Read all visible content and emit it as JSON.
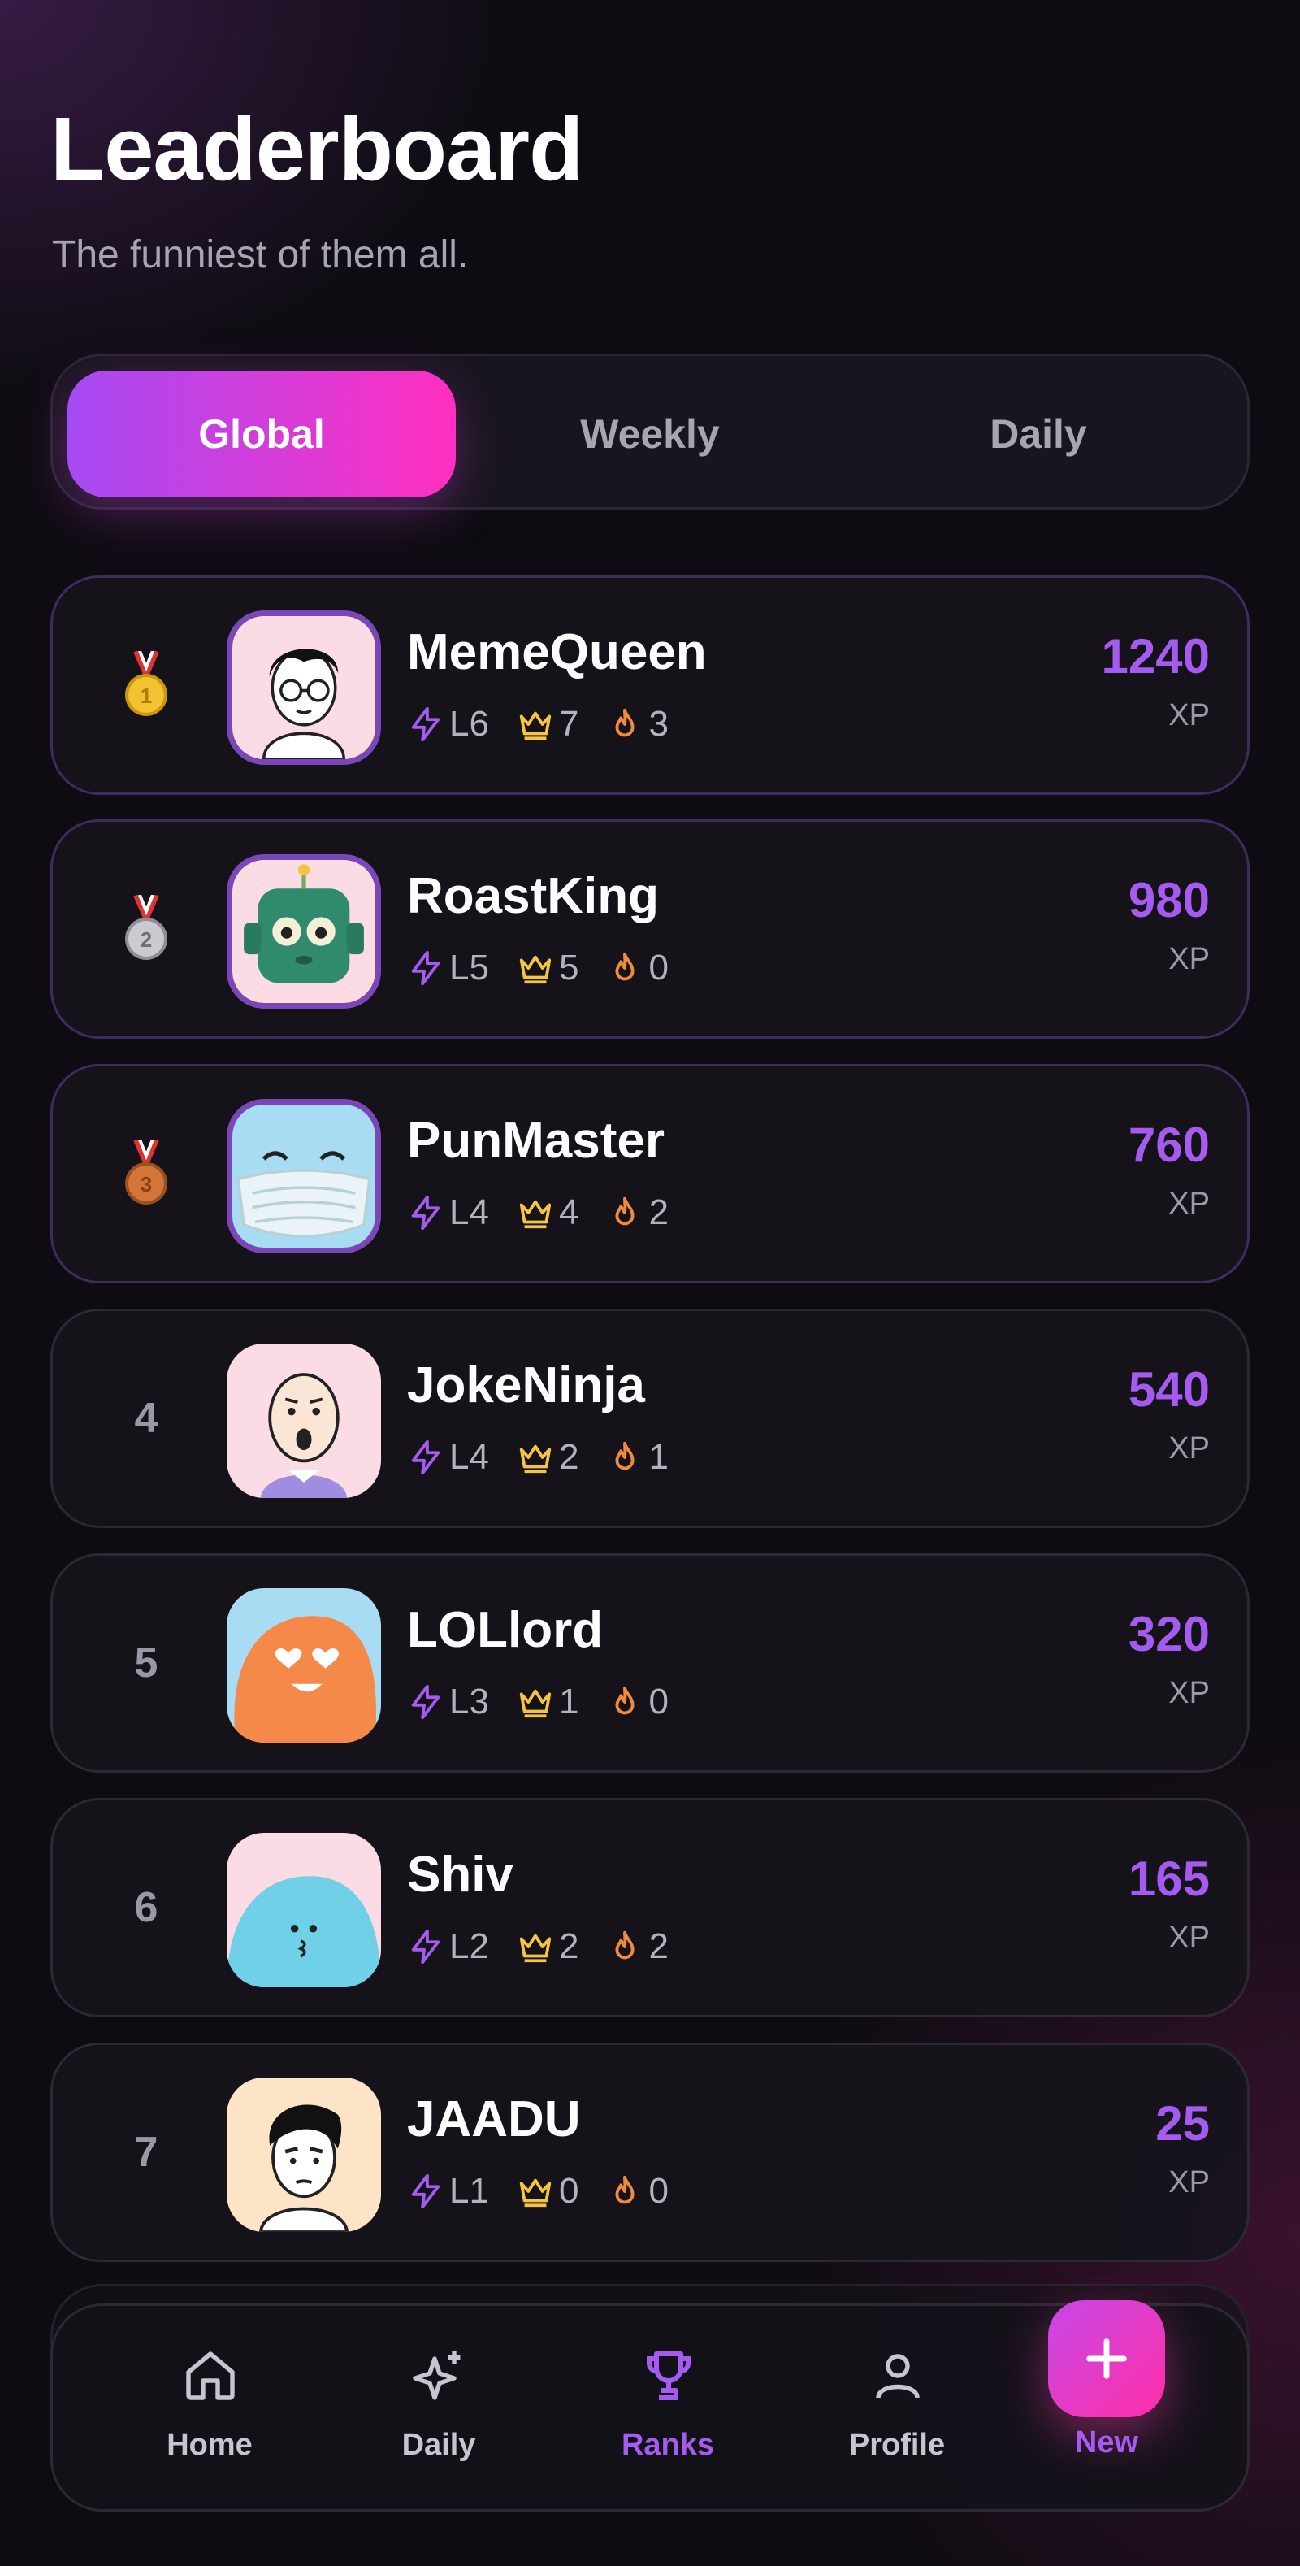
{
  "header": {
    "title": "Leaderboard",
    "subtitle": "The funniest of them all."
  },
  "tabs": [
    {
      "label": "Global",
      "active": true
    },
    {
      "label": "Weekly",
      "active": false
    },
    {
      "label": "Daily",
      "active": false
    }
  ],
  "leaderboard": [
    {
      "rank": "1",
      "medal": "gold",
      "name": "MemeQueen",
      "level": "L6",
      "crowns": "7",
      "streak": "3",
      "score": "1240",
      "unit": "XP",
      "avatar": "glasses-guy-avatar"
    },
    {
      "rank": "2",
      "medal": "silver",
      "name": "RoastKing",
      "level": "L5",
      "crowns": "5",
      "streak": "0",
      "score": "980",
      "unit": "XP",
      "avatar": "green-robot-avatar"
    },
    {
      "rank": "3",
      "medal": "bronze",
      "name": "PunMaster",
      "level": "L4",
      "crowns": "4",
      "streak": "2",
      "score": "760",
      "unit": "XP",
      "avatar": "face-mask-avatar"
    },
    {
      "rank": "4",
      "medal": null,
      "name": "JokeNinja",
      "level": "L4",
      "crowns": "2",
      "streak": "1",
      "score": "540",
      "unit": "XP",
      "avatar": "bald-man-avatar"
    },
    {
      "rank": "5",
      "medal": null,
      "name": "LOLlord",
      "level": "L3",
      "crowns": "1",
      "streak": "0",
      "score": "320",
      "unit": "XP",
      "avatar": "heart-eyes-blob-avatar"
    },
    {
      "rank": "6",
      "medal": null,
      "name": "Shiv",
      "level": "L2",
      "crowns": "2",
      "streak": "2",
      "score": "165",
      "unit": "XP",
      "avatar": "blue-kiss-blob-avatar"
    },
    {
      "rank": "7",
      "medal": null,
      "name": "JAADU",
      "level": "L1",
      "crowns": "0",
      "streak": "0",
      "score": "25",
      "unit": "XP",
      "avatar": "dark-hair-man-avatar"
    }
  ],
  "nav": {
    "items": [
      {
        "label": "Home",
        "icon": "home-icon",
        "active": false
      },
      {
        "label": "Daily",
        "icon": "sparkle-icon",
        "active": false
      },
      {
        "label": "Ranks",
        "icon": "trophy-icon",
        "active": true
      },
      {
        "label": "Profile",
        "icon": "user-icon",
        "active": false
      }
    ],
    "fab_label": "New",
    "fab_icon": "plus-icon"
  },
  "colors": {
    "accent_purple": "#a55bf0",
    "accent_pink": "#ff2fc0",
    "crown_gold": "#f5c542",
    "flame_orange": "#f08a3c",
    "bolt_purple": "#a55bf0"
  }
}
